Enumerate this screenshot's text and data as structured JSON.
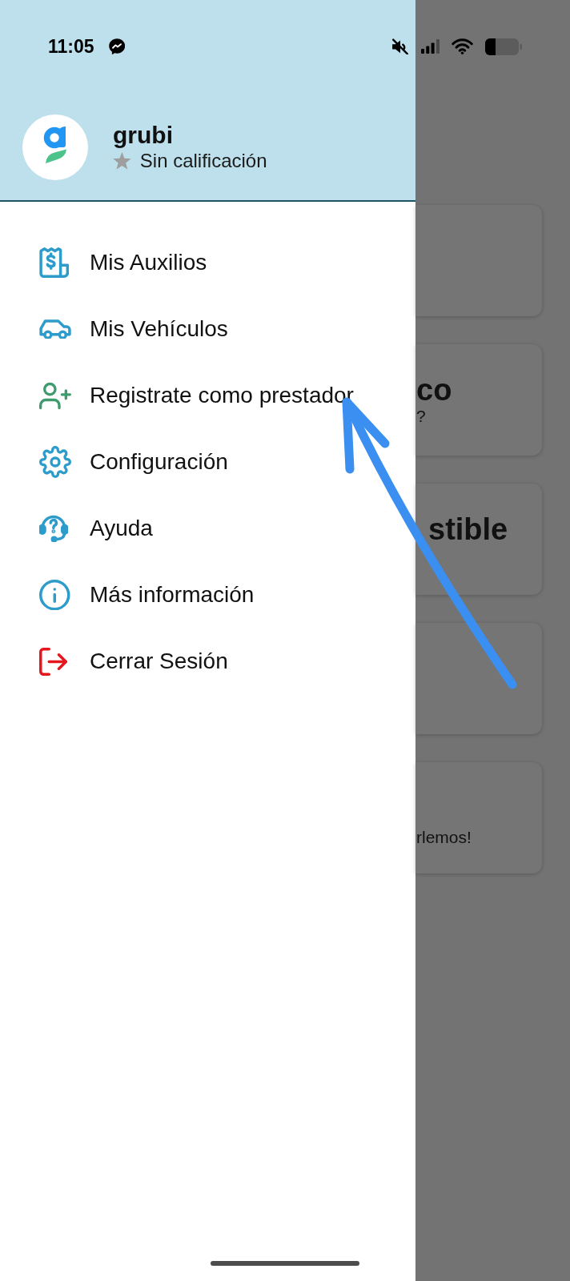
{
  "status_bar": {
    "time": "11:05"
  },
  "profile": {
    "name": "grubi",
    "rating": "Sin calificación"
  },
  "menu": {
    "items": [
      {
        "label": "Mis Auxilios",
        "color": "#2e9ccb"
      },
      {
        "label": "Mis Vehículos",
        "color": "#2e9ccb"
      },
      {
        "label": "Registrate como prestador",
        "color": "#3f9a6e"
      },
      {
        "label": "Configuración",
        "color": "#2e9ccb"
      },
      {
        "label": "Ayuda",
        "color": "#2e9ccb"
      },
      {
        "label": "Más información",
        "color": "#2e9ccb"
      },
      {
        "label": "Cerrar Sesión",
        "color": "#e3171c"
      }
    ]
  },
  "background_cards": [
    {
      "kind": "blank"
    },
    {
      "kind": "text",
      "title": "co",
      "subtitle": "?"
    },
    {
      "kind": "text",
      "title": "stible"
    },
    {
      "kind": "blank"
    },
    {
      "kind": "text",
      "subtitle": "rlemos!"
    }
  ]
}
